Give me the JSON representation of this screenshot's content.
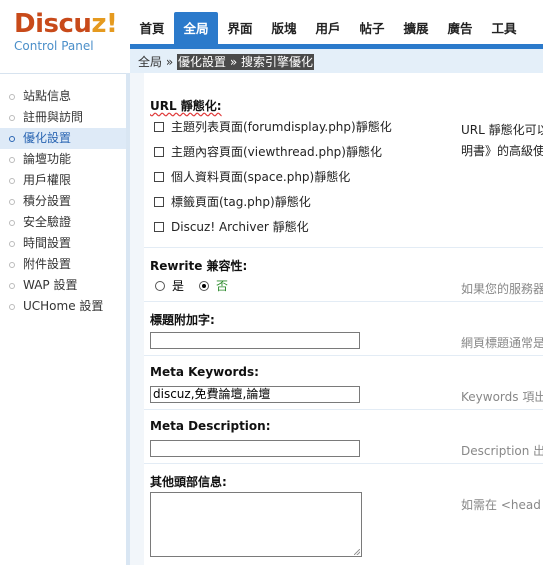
{
  "logo": {
    "brand_part1": "Discu",
    "brand_part2": "z!",
    "subtitle": "Control Panel"
  },
  "topnav": {
    "tabs": [
      {
        "label": "首頁"
      },
      {
        "label": "全局",
        "active": true
      },
      {
        "label": "界面"
      },
      {
        "label": "版塊"
      },
      {
        "label": "用戶"
      },
      {
        "label": "帖子"
      },
      {
        "label": "擴展"
      },
      {
        "label": "廣告"
      },
      {
        "label": "工具"
      }
    ]
  },
  "breadcrumb": {
    "root": "全局",
    "sep": " » ",
    "selected": "優化設置 » 搜索引擎優化"
  },
  "sidebar": {
    "items": [
      {
        "label": "站點信息"
      },
      {
        "label": "註冊與訪問"
      },
      {
        "label": "優化設置",
        "active": true
      },
      {
        "label": "論壇功能"
      },
      {
        "label": "用戶權限"
      },
      {
        "label": "積分設置"
      },
      {
        "label": "安全驗證"
      },
      {
        "label": "時間設置"
      },
      {
        "label": "附件設置"
      },
      {
        "label": "WAP 設置"
      },
      {
        "label": "UCHome 設置"
      }
    ]
  },
  "url_static": {
    "label": "URL 靜態化:",
    "options": [
      {
        "label": "主題列表頁面(forumdisplay.php)靜態化",
        "checked": false
      },
      {
        "label": "主題內容頁面(viewthread.php)靜態化",
        "checked": false
      },
      {
        "label": "個人資料頁面(space.php)靜態化",
        "checked": false
      },
      {
        "label": "標籤頁面(tag.php)靜態化",
        "checked": false
      },
      {
        "label": "Discuz! Archiver 靜態化",
        "checked": false
      }
    ],
    "hint_line1": "URL 靜態化可以",
    "hint_line2": "明書》的高級使"
  },
  "rewrite": {
    "label": "Rewrite 兼容性:",
    "options": [
      {
        "label": "是",
        "selected": false
      },
      {
        "label": "否",
        "selected": true
      }
    ],
    "hint": "如果您的服務器"
  },
  "title_suffix": {
    "label": "標題附加字:",
    "value": "",
    "hint": "網頁標題通常是"
  },
  "meta_keywords": {
    "label": "Meta Keywords:",
    "value": "discuz,免費論壇,論壇",
    "hint": "Keywords 項出"
  },
  "meta_description": {
    "label": "Meta Description:",
    "value": "",
    "hint": "Description 出"
  },
  "other_head": {
    "label": "其他頭部信息:",
    "value": "",
    "hint": "如需在 <head"
  },
  "colors": {
    "accent": "#2b7acb",
    "brand_red": "#c84a1a",
    "brand_orange": "#e59a1f",
    "subtitle_blue": "#4b8fc9",
    "active_radio_text": "#2a8a2a"
  }
}
